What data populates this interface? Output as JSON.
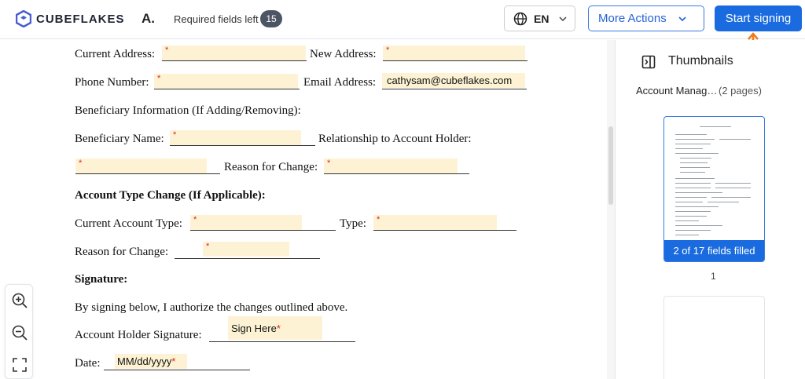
{
  "header": {
    "logo_text": "CUBEFLAKES",
    "initial": "A.",
    "required_label": "Required fields left",
    "required_count": "15",
    "language": "EN",
    "more_actions": "More Actions",
    "start_signing": "Start signing"
  },
  "colors": {
    "accent": "#1a6be0",
    "field_bg": "#fdf3d4",
    "required_star": "#e02020",
    "arrow": "#f07a1a"
  },
  "document": {
    "current_address": "Current Address:",
    "new_address": "New Address:",
    "phone_number": "Phone Number:",
    "email_address": "Email Address:",
    "email_value": "cathysam@cubeflakes.com",
    "beneficiary_info": "Beneficiary Information (If Adding/Removing):",
    "beneficiary_name": "Beneficiary Name:",
    "relationship": "Relationship to Account Holder:",
    "reason_change_1": "Reason for Change:",
    "account_type_heading": "Account Type Change (If Applicable):",
    "current_account_type": "Current Account Type:",
    "type": "Type:",
    "reason_change_2": "Reason for Change:",
    "signature_heading": "Signature:",
    "authorize_text": "By signing below, I authorize the changes outlined above.",
    "holder_signature": "Account Holder Signature:",
    "sign_here": "Sign Here",
    "date": "Date:",
    "date_placeholder": "MM/dd/yyyy",
    "required_mark": "*"
  },
  "sidebar": {
    "title": "Thumbnails",
    "doc_name": "Account Manag…",
    "doc_pages": "(2 pages)",
    "fields_filled": "2 of 17 fields filled",
    "page_number": "1"
  },
  "icons": {
    "logo": "cube-logo-icon",
    "language": "globe-icon",
    "dropdown": "chevron-down-icon",
    "arrow": "arrow-up-icon",
    "thumbnails": "sidebar-panel-icon",
    "zoom_in": "zoom-in-icon",
    "zoom_out": "zoom-out-icon",
    "fit": "fit-screen-icon"
  }
}
